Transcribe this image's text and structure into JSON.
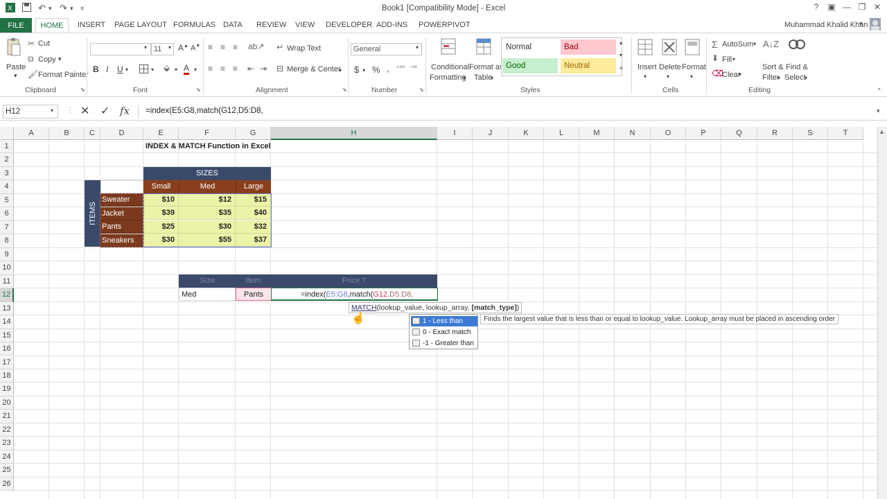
{
  "window": {
    "title": "Book1  [Compatibility Mode] - Excel",
    "user": "Muhammad Khalid Khan"
  },
  "tabs": [
    "FILE",
    "HOME",
    "INSERT",
    "PAGE LAYOUT",
    "FORMULAS",
    "DATA",
    "REVIEW",
    "VIEW",
    "DEVELOPER",
    "ADD-INS",
    "POWERPIVOT"
  ],
  "ribbon": {
    "clipboard": {
      "paste": "Paste",
      "cut": "Cut",
      "copy": "Copy",
      "format_painter": "Format Painter",
      "label": "Clipboard"
    },
    "font": {
      "size": "11",
      "bold": "B",
      "italic": "I",
      "underline": "U",
      "label": "Font"
    },
    "alignment": {
      "wrap": "Wrap Text",
      "merge": "Merge & Center",
      "label": "Alignment"
    },
    "number": {
      "format": "General",
      "currency": "$",
      "percent": "%",
      "comma": ",",
      "label": "Number"
    },
    "styles": {
      "conditional": "Conditional",
      "formatting": "Formatting",
      "format_as": "Format as",
      "table": "Table",
      "normal": "Normal",
      "bad": "Bad",
      "good": "Good",
      "neutral": "Neutral",
      "label": "Styles"
    },
    "cells": {
      "insert": "Insert",
      "delete": "Delete",
      "format": "Format",
      "label": "Cells"
    },
    "editing": {
      "autosum": "AutoSum",
      "fill": "Fill",
      "clear": "Clear",
      "sort": "Sort &",
      "filter": "Filter",
      "find": "Find &",
      "select": "Select",
      "label": "Editing"
    }
  },
  "formula_bar": {
    "name_box": "H12",
    "formula": "=index(E5:G8,match(G12,D5:D8,",
    "fx": "fx"
  },
  "columns": [
    "A",
    "B",
    "C",
    "D",
    "E",
    "F",
    "G",
    "H",
    "I",
    "J",
    "K",
    "L",
    "M",
    "N",
    "O",
    "P",
    "Q",
    "R",
    "S",
    "T"
  ],
  "rows": [
    "1",
    "2",
    "3",
    "4",
    "5",
    "6",
    "7",
    "8",
    "9",
    "10",
    "11",
    "12",
    "13",
    "14",
    "15",
    "16",
    "17",
    "18",
    "19",
    "20",
    "21",
    "22",
    "23",
    "24",
    "25",
    "26"
  ],
  "sheet": {
    "heading": "INDEX & MATCH Function in Excel",
    "sizes_header": "SIZES",
    "items_header": "ITEMS",
    "size_cols": [
      "Small",
      "Med",
      "Large"
    ],
    "items": [
      "Sweater",
      "Jacket",
      "Pants",
      "Sneakers"
    ],
    "prices": [
      [
        "$10",
        "$12",
        "$15"
      ],
      [
        "$39",
        "$35",
        "$40"
      ],
      [
        "$25",
        "$30",
        "$32"
      ],
      [
        "$30",
        "$55",
        "$37"
      ]
    ],
    "lookup_headers": [
      "Size",
      "Item",
      "Price ?"
    ],
    "lookup_values": {
      "size": "Med",
      "item": "Pants",
      "formula_prefix": "=index(",
      "formula_ref1": "E5:G8",
      "formula_mid": ",match(",
      "formula_ref2": "G12",
      "formula_rest": ",D5:D8,"
    }
  },
  "tooltip": {
    "fn": "MATCH",
    "args": "(lookup_value, lookup_array, ",
    "bold_arg": "[match_type]",
    "close": ")"
  },
  "autocomplete": {
    "options": [
      "1 - Less than",
      "0 - Exact match",
      "-1 - Greater than"
    ],
    "description": "Finds the largest value that is less than or equal to lookup_value. Lookup_array must be placed in ascending order"
  },
  "colors": {
    "excel_green": "#217346",
    "header_navy": "#3b4a6b",
    "item_brown": "#7b3a1e",
    "size_brown": "#8a3f1c",
    "price_yellow": "#ecf3a8"
  }
}
